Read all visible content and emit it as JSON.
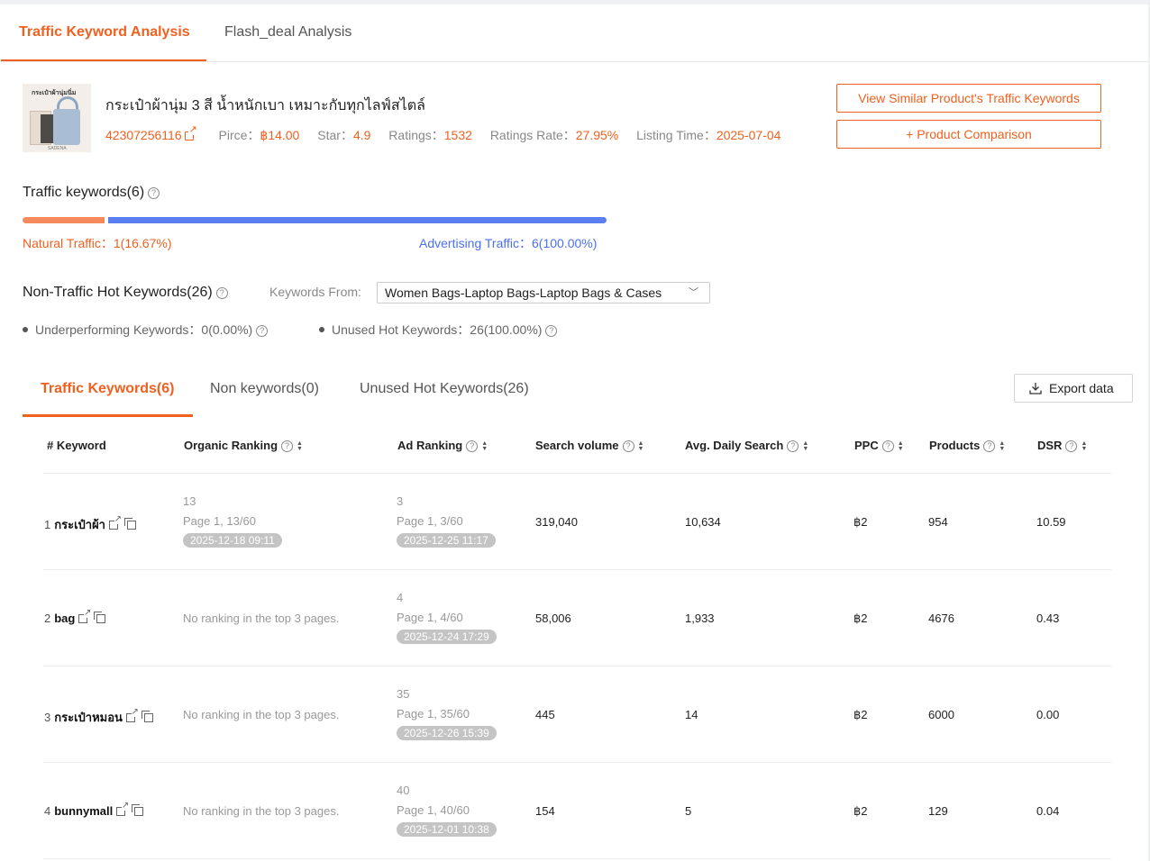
{
  "tabs": [
    "Traffic Keyword Analysis",
    "Flash_deal Analysis"
  ],
  "product": {
    "title": "กระเป๋าผ้านุ่ม 3 สี น้ำหนักเบา เหมาะกับทุกไลฟ์สไตล์",
    "thumb_caption": "กระเป๋าผ้านุ่มนิ่ม",
    "thumb_brand": "SADENA",
    "id": "42307256116",
    "price_label": "Pirce：",
    "price": "฿14.00",
    "star_label": "Star：",
    "star": "4.9",
    "ratings_label": "Ratings：",
    "ratings": "1532",
    "ratings_rate_label": "Ratings Rate：",
    "ratings_rate": "27.95%",
    "listing_label": "Listing Time：",
    "listing_time": "2025-07-04"
  },
  "buttons": {
    "similar": "View Similar Product's Traffic Keywords",
    "comparison": "+  Product Comparison",
    "export": "Export data"
  },
  "traffic": {
    "title": "Traffic keywords(6)",
    "natural_label": "Natural Traffic：1(16.67%)",
    "advertising_label": "Advertising Traffic：6(100.00%)",
    "natural_share": 0.1667,
    "advertising_share": 1.0,
    "natural_color": "#f58a5c",
    "advertising_color": "#5b7ff0"
  },
  "nonTraffic": {
    "title": "Non-Traffic Hot Keywords(26)",
    "from_label": "Keywords From:",
    "from_value": "Women Bags-Laptop Bags-Laptop Bags & Cases",
    "underperforming": "Underperforming Keywords：0(0.00%)",
    "unused": "Unused Hot Keywords：26(100.00%)"
  },
  "subtabs": [
    "Traffic Keywords(6)",
    "Non keywords(0)",
    "Unused Hot Keywords(26)"
  ],
  "table": {
    "headers": {
      "hash": "#",
      "keyword": "Keyword",
      "organic": "Organic Ranking",
      "ad": "Ad Ranking",
      "search": "Search volume",
      "avg": "Avg. Daily Search",
      "ppc": "PPC",
      "products": "Products",
      "dsr": "DSR"
    },
    "rows": [
      {
        "idx": "1",
        "keyword": "กระเป๋าผ้า",
        "org_rank": "13",
        "org_page": "Page 1, 13/60",
        "org_date": "2025-12-18 09:11",
        "org_none": "",
        "ad_rank": "3",
        "ad_page": "Page 1, 3/60",
        "ad_date": "2025-12-25 11:17",
        "search": "319,040",
        "avg": "10,634",
        "ppc": "฿2",
        "products": "954",
        "dsr": "10.59"
      },
      {
        "idx": "2",
        "keyword": "bag",
        "org_rank": "",
        "org_page": "",
        "org_date": "",
        "org_none": "No ranking in the top 3 pages.",
        "ad_rank": "4",
        "ad_page": "Page 1, 4/60",
        "ad_date": "2025-12-24 17:29",
        "search": "58,006",
        "avg": "1,933",
        "ppc": "฿2",
        "products": "4676",
        "dsr": "0.43"
      },
      {
        "idx": "3",
        "keyword": "กระเป๋าหมอน",
        "org_rank": "",
        "org_page": "",
        "org_date": "",
        "org_none": "No ranking in the top 3 pages.",
        "ad_rank": "35",
        "ad_page": "Page 1, 35/60",
        "ad_date": "2025-12-26 15:39",
        "search": "445",
        "avg": "14",
        "ppc": "฿2",
        "products": "6000",
        "dsr": "0.00"
      },
      {
        "idx": "4",
        "keyword": "bunnymall",
        "org_rank": "",
        "org_page": "",
        "org_date": "",
        "org_none": "No ranking in the top 3 pages.",
        "ad_rank": "40",
        "ad_page": "Page 1, 40/60",
        "ad_date": "2025-12-01 10:38",
        "search": "154",
        "avg": "5",
        "ppc": "฿2",
        "products": "129",
        "dsr": "0.04"
      }
    ]
  }
}
